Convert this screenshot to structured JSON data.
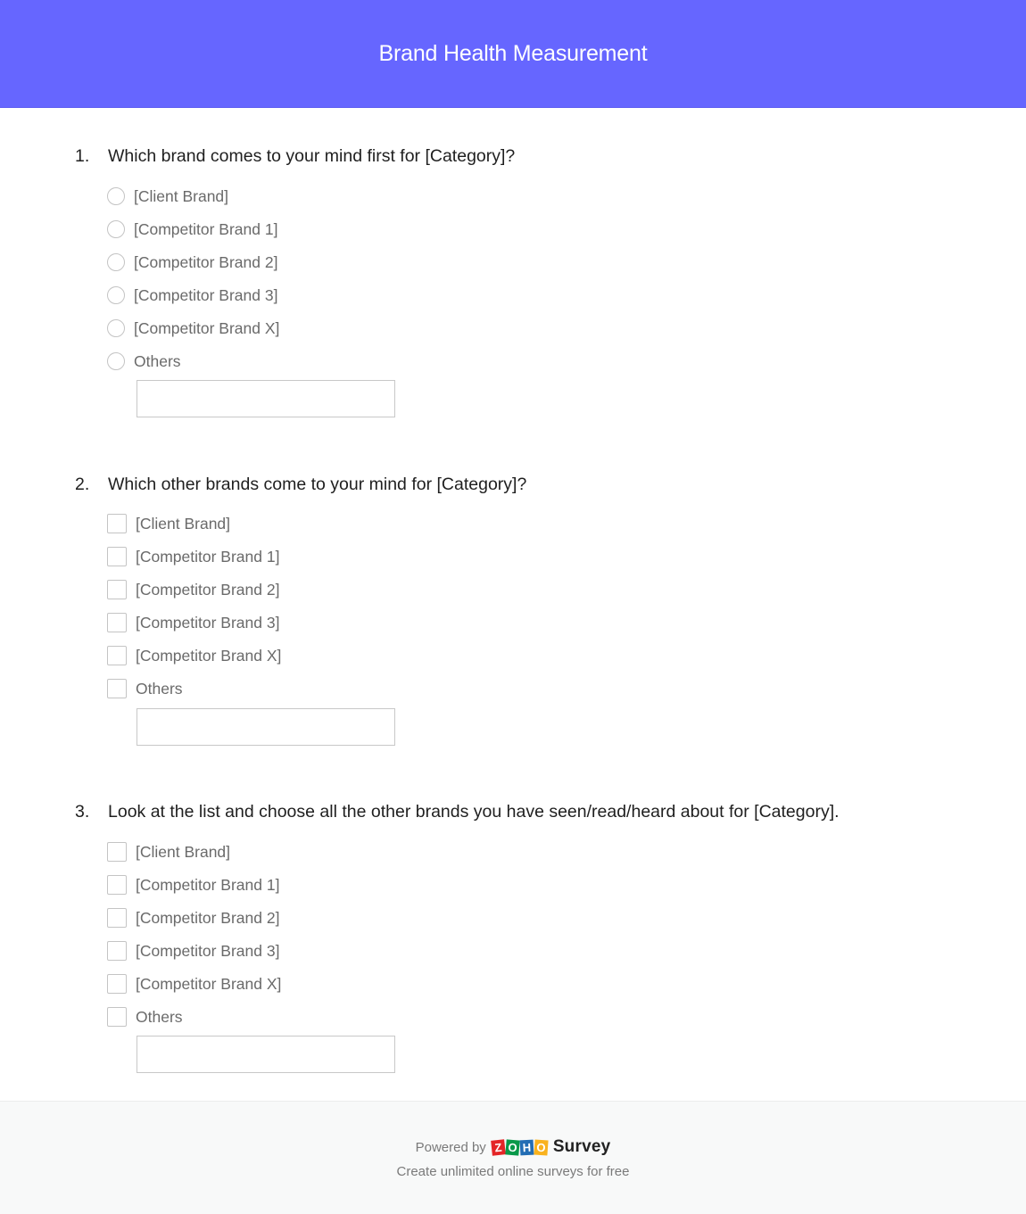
{
  "header": {
    "title": "Brand Health Measurement",
    "background_color": "#6666ff"
  },
  "questions": [
    {
      "number": "1.",
      "text": "Which brand comes to your mind first for [Category]?",
      "type": "radio",
      "options": [
        "[Client Brand]",
        "[Competitor Brand 1]",
        "[Competitor Brand 2]",
        "[Competitor Brand 3]",
        "[Competitor Brand X]",
        "Others"
      ],
      "other_input_value": "",
      "other_input_placeholder": ""
    },
    {
      "number": "2.",
      "text": "Which other brands come to your mind for [Category]?",
      "type": "checkbox",
      "options": [
        "[Client Brand]",
        "[Competitor Brand 1]",
        "[Competitor Brand 2]",
        "[Competitor Brand 3]",
        "[Competitor Brand X]",
        "Others"
      ],
      "other_input_value": "",
      "other_input_placeholder": ""
    },
    {
      "number": "3.",
      "text": "Look at the list and choose all the other brands you have seen/read/heard about for [Category].",
      "type": "checkbox",
      "options": [
        "[Client Brand]",
        "[Competitor Brand 1]",
        "[Competitor Brand 2]",
        "[Competitor Brand 3]",
        "[Competitor Brand X]",
        "Others"
      ],
      "other_input_value": "",
      "other_input_placeholder": ""
    }
  ],
  "footer": {
    "powered_by": "Powered by",
    "logo_letters": [
      {
        "char": "Z",
        "color": "#e42527"
      },
      {
        "char": "O",
        "color": "#089949"
      },
      {
        "char": "H",
        "color": "#226db4"
      },
      {
        "char": "O",
        "color": "#f9b21d"
      }
    ],
    "product": "Survey",
    "tagline": "Create unlimited online surveys for free"
  }
}
